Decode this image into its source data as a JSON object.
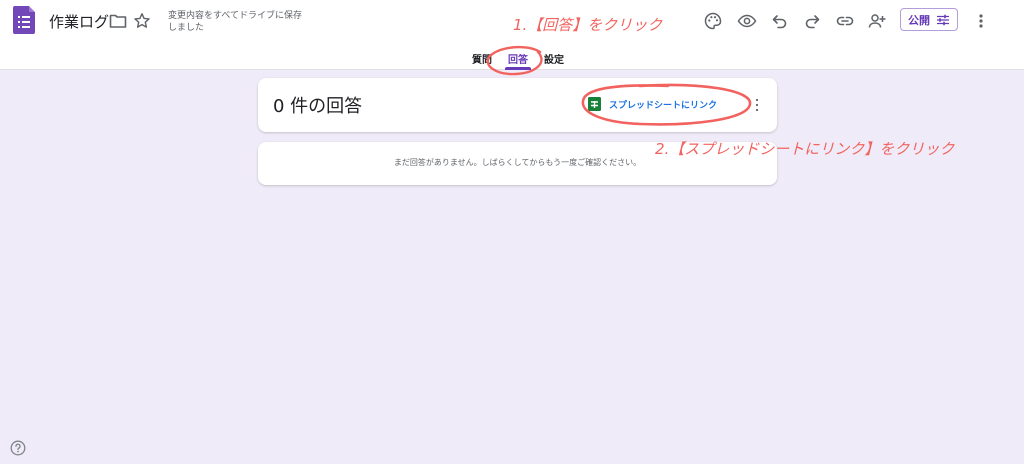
{
  "header": {
    "doc_title": "作業ログ",
    "save_status": "変更内容をすべてドライブに保存しました",
    "publish_label": "公開",
    "icons": [
      "forms-logo-icon",
      "folder-icon",
      "star-icon",
      "palette-icon",
      "eye-icon",
      "undo-icon",
      "redo-icon",
      "link-icon",
      "add-collaborator-icon",
      "tune-icon",
      "more-vert-icon"
    ]
  },
  "tabs": [
    {
      "label": "質問",
      "active": false
    },
    {
      "label": "回答",
      "active": true
    },
    {
      "label": "設定",
      "active": false
    }
  ],
  "responses": {
    "count_text": "0 件の回答",
    "sheet_link_label": "スプレッドシートにリンク",
    "empty_message": "まだ回答がありません。しばらくしてからもう一度ご確認ください。"
  },
  "annotations": {
    "step1": "1.【回答】をクリック",
    "step2": "2.【スプレッドシートにリンク】をクリック",
    "color": "#f2635f"
  },
  "colors": {
    "background": "#f0ebf8",
    "accent": "#673ab7",
    "link": "#1a73e8",
    "sheets_green": "#188038"
  }
}
